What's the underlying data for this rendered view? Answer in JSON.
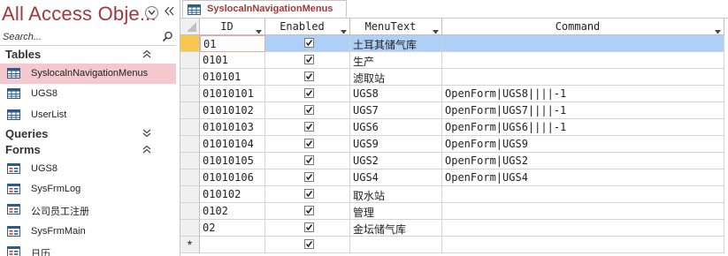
{
  "nav": {
    "title": "All Access Obje...",
    "search_placeholder": "Search...",
    "groups": [
      {
        "label": "Tables",
        "items": [
          {
            "label": "SyslocalnNavigationMenus",
            "selected": true
          },
          {
            "label": "UGS8"
          },
          {
            "label": "UserList"
          }
        ]
      },
      {
        "label": "Queries",
        "items": []
      },
      {
        "label": "Forms",
        "items": [
          {
            "label": "UGS8"
          },
          {
            "label": "SysFrmLog"
          },
          {
            "label": "公司员工注册"
          },
          {
            "label": "SysFrmMain"
          },
          {
            "label": "日历"
          }
        ]
      }
    ]
  },
  "tab": {
    "label": "SyslocalnNavigationMenus"
  },
  "grid": {
    "columns": [
      {
        "label": "ID"
      },
      {
        "label": "Enabled"
      },
      {
        "label": "MenuText"
      },
      {
        "label": "Command"
      }
    ],
    "rows": [
      {
        "id": "01",
        "enabled": true,
        "menutext": "土耳其储气库",
        "command": ""
      },
      {
        "id": "0101",
        "enabled": true,
        "menutext": "生产",
        "command": ""
      },
      {
        "id": "010101",
        "enabled": true,
        "menutext": "滤取站",
        "command": ""
      },
      {
        "id": "01010101",
        "enabled": true,
        "menutext": "UGS8",
        "command": "OpenForm|UGS8||||-1"
      },
      {
        "id": "01010102",
        "enabled": true,
        "menutext": "UGS7",
        "command": "OpenForm|UGS7||||-1"
      },
      {
        "id": "01010103",
        "enabled": true,
        "menutext": "UGS6",
        "command": "OpenForm|UGS6||||-1"
      },
      {
        "id": "01010104",
        "enabled": true,
        "menutext": "UGS9",
        "command": "OpenForm|UGS9"
      },
      {
        "id": "01010105",
        "enabled": true,
        "menutext": "UGS2",
        "command": "OpenForm|UGS2"
      },
      {
        "id": "01010106",
        "enabled": true,
        "menutext": "UGS4",
        "command": "OpenForm|UGS4"
      },
      {
        "id": "010102",
        "enabled": true,
        "menutext": "取水站",
        "command": ""
      },
      {
        "id": "0102",
        "enabled": true,
        "menutext": "管理",
        "command": ""
      },
      {
        "id": "02",
        "enabled": true,
        "menutext": "金坛储气库",
        "command": ""
      }
    ],
    "new_row_marker": "*",
    "new_row_enabled": true
  },
  "colors": {
    "accent": "#a4373a",
    "selected_nav": "#f4c8cc",
    "selected_row": "#aed0f7",
    "record_selector": "#f9c74f"
  }
}
